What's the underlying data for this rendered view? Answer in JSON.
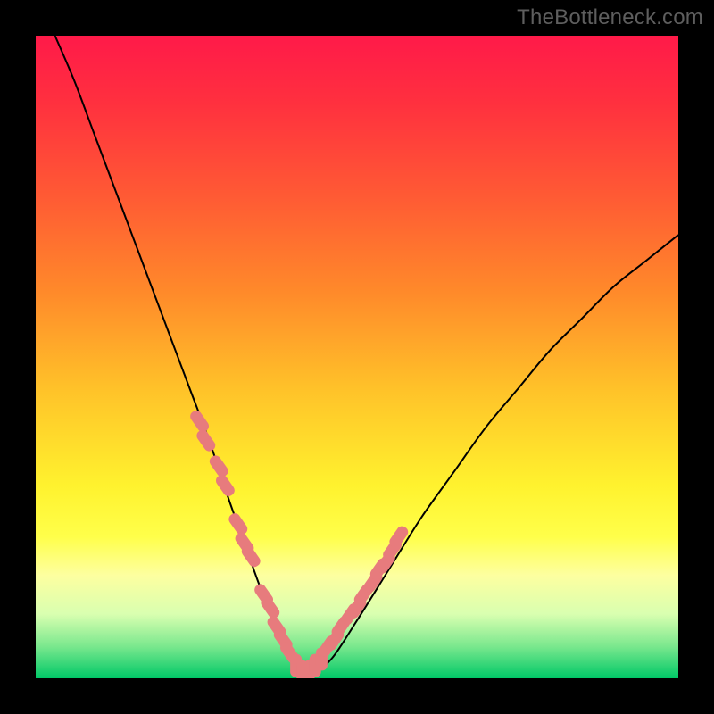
{
  "watermark": {
    "text": "TheBottleneck.com"
  },
  "colors": {
    "frame": "#000000",
    "curve": "#000000",
    "marker": "#e77b7d",
    "gradient_stops": [
      {
        "offset": 0.0,
        "color": "#ff1a49"
      },
      {
        "offset": 0.1,
        "color": "#ff2f3f"
      },
      {
        "offset": 0.25,
        "color": "#ff5a34"
      },
      {
        "offset": 0.4,
        "color": "#ff8a2a"
      },
      {
        "offset": 0.55,
        "color": "#ffc229"
      },
      {
        "offset": 0.7,
        "color": "#fff22e"
      },
      {
        "offset": 0.78,
        "color": "#ffff4a"
      },
      {
        "offset": 0.84,
        "color": "#fdffa0"
      },
      {
        "offset": 0.9,
        "color": "#d9ffb0"
      },
      {
        "offset": 0.95,
        "color": "#7be88e"
      },
      {
        "offset": 1.0,
        "color": "#00c867"
      }
    ]
  },
  "chart_data": {
    "type": "line",
    "title": "",
    "xlabel": "",
    "ylabel": "",
    "xlim": [
      0,
      1
    ],
    "ylim": [
      0,
      1
    ],
    "series": [
      {
        "name": "bottleneck-curve",
        "x": [
          0.03,
          0.06,
          0.09,
          0.12,
          0.15,
          0.18,
          0.21,
          0.24,
          0.27,
          0.3,
          0.325,
          0.35,
          0.375,
          0.4,
          0.43,
          0.46,
          0.5,
          0.55,
          0.6,
          0.65,
          0.7,
          0.75,
          0.8,
          0.85,
          0.9,
          0.95,
          1.0
        ],
        "y": [
          1.0,
          0.93,
          0.85,
          0.77,
          0.69,
          0.61,
          0.53,
          0.45,
          0.37,
          0.28,
          0.21,
          0.14,
          0.08,
          0.03,
          0.01,
          0.03,
          0.09,
          0.17,
          0.25,
          0.32,
          0.39,
          0.45,
          0.51,
          0.56,
          0.61,
          0.65,
          0.69
        ]
      }
    ],
    "markers": [
      {
        "name": "highlighted-points",
        "x": [
          0.255,
          0.265,
          0.285,
          0.295,
          0.315,
          0.325,
          0.335,
          0.355,
          0.365,
          0.375,
          0.385,
          0.395,
          0.405,
          0.415,
          0.425,
          0.435,
          0.445,
          0.455,
          0.465,
          0.475,
          0.49,
          0.5,
          0.51,
          0.525,
          0.535,
          0.545,
          0.555,
          0.565
        ],
        "y": [
          0.4,
          0.37,
          0.33,
          0.3,
          0.24,
          0.21,
          0.19,
          0.13,
          0.11,
          0.08,
          0.06,
          0.04,
          0.02,
          0.01,
          0.01,
          0.02,
          0.03,
          0.05,
          0.06,
          0.08,
          0.1,
          0.11,
          0.13,
          0.15,
          0.17,
          0.18,
          0.2,
          0.22
        ]
      }
    ]
  }
}
